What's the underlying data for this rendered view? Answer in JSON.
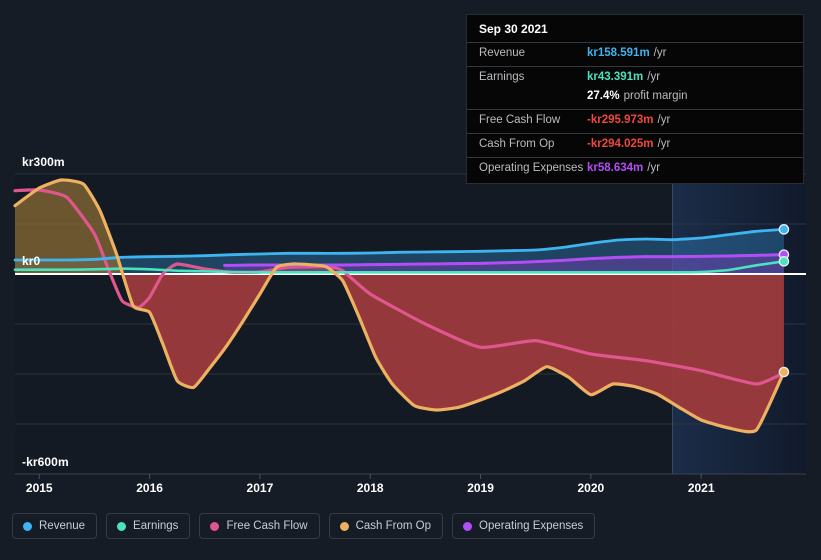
{
  "currency_prefix": "kr",
  "colors": {
    "background": "#151c26",
    "plot_background": "#131a24",
    "forecast_background": "#142034",
    "revenue": "#3eb4f0",
    "earnings": "#4ae3bd",
    "free_cash_flow": "#e0568f",
    "cash_from_op": "#edb161",
    "operating_expenses": "#b24ef5",
    "zero_line": "#ffffff",
    "grid": "#2c333d",
    "negative_fill": "#8d3a3c",
    "tooltip_background": "#060606",
    "tooltip_border": "#2a2d31"
  },
  "tooltip": {
    "title": "Sep 30 2021",
    "rows": [
      {
        "key": "Revenue",
        "value": "kr158.591m",
        "unit": "/yr",
        "color_key": "revenue"
      },
      {
        "key": "Earnings",
        "value": "kr43.391m",
        "unit": "/yr",
        "color_key": "earnings"
      },
      {
        "key": "",
        "value": "27.4%",
        "unit": "profit margin",
        "color_key": "white"
      },
      {
        "key": "Free Cash Flow",
        "value": "-kr295.973m",
        "unit": "/yr",
        "color_key": "negative"
      },
      {
        "key": "Cash From Op",
        "value": "-kr294.025m",
        "unit": "/yr",
        "color_key": "negative"
      },
      {
        "key": "Operating Expenses",
        "value": "kr58.634m",
        "unit": "/yr",
        "color_key": "operating_expenses"
      }
    ]
  },
  "legend": [
    {
      "label": "Revenue",
      "color": "#3eb4f0"
    },
    {
      "label": "Earnings",
      "color": "#4ae3bd"
    },
    {
      "label": "Free Cash Flow",
      "color": "#e0568f"
    },
    {
      "label": "Cash From Op",
      "color": "#edb161"
    },
    {
      "label": "Operating Expenses",
      "color": "#b24ef5"
    }
  ],
  "y_axis": {
    "top_label": "kr300m",
    "zero_label": "kr0",
    "bottom_label": "-kr600m"
  },
  "x_axis": {
    "ticks": [
      "2015",
      "2016",
      "2017",
      "2018",
      "2019",
      "2020",
      "2021"
    ]
  },
  "chart_data": {
    "type": "line",
    "title": "",
    "xlabel": "",
    "ylabel": "",
    "ylim": [
      -600,
      300
    ],
    "xlim": [
      2014.78,
      2021.95
    ],
    "grid": true,
    "legend_position": "bottom",
    "y_ticks": [
      300,
      150,
      0,
      -150,
      -300,
      -450,
      -600
    ],
    "y_tick_labels": [
      "kr300m",
      "",
      "kr0",
      "",
      "",
      "",
      "-kr600m"
    ],
    "x_ticks": [
      2015,
      2016,
      2017,
      2018,
      2019,
      2020,
      2021
    ],
    "forecast_start": 2020.74,
    "units": "millions of kr (NOK)",
    "series": [
      {
        "name": "Revenue",
        "color": "#3eb4f0",
        "x": [
          2014.78,
          2015.0,
          2015.25,
          2015.5,
          2015.75,
          2016.0,
          2016.25,
          2016.5,
          2016.75,
          2017.0,
          2017.25,
          2017.5,
          2017.75,
          2018.0,
          2018.25,
          2018.5,
          2018.75,
          2019.0,
          2019.25,
          2019.5,
          2019.75,
          2020.0,
          2020.25,
          2020.5,
          2020.74,
          2021.0,
          2021.25,
          2021.5,
          2021.75
        ],
        "values": [
          42,
          42,
          42,
          44,
          50,
          52,
          53,
          55,
          58,
          60,
          62,
          62,
          62,
          63,
          65,
          66,
          67,
          68,
          70,
          72,
          80,
          92,
          102,
          105,
          103,
          108,
          118,
          128,
          134
        ]
      },
      {
        "name": "Earnings",
        "color": "#4ae3bd",
        "x": [
          2014.78,
          2015.0,
          2015.25,
          2015.5,
          2015.75,
          2016.0,
          2016.25,
          2016.5,
          2016.75,
          2017.0,
          2017.25,
          2017.5,
          2017.75,
          2018.0,
          2018.25,
          2018.5,
          2018.75,
          2019.0,
          2019.25,
          2019.5,
          2019.75,
          2020.0,
          2020.25,
          2020.5,
          2020.74,
          2021.0,
          2021.25,
          2021.5,
          2021.75
        ],
        "values": [
          13,
          13,
          13,
          14,
          16,
          14,
          10,
          8,
          6,
          5,
          5,
          5,
          5,
          5,
          5,
          5,
          5,
          5,
          5,
          5,
          5,
          5,
          5,
          5,
          5,
          6,
          12,
          26,
          38
        ]
      },
      {
        "name": "Free Cash Flow",
        "color": "#e0568f",
        "x": [
          2014.78,
          2015.0,
          2015.25,
          2015.5,
          2015.62,
          2015.75,
          2015.9,
          2016.0,
          2016.12,
          2016.25,
          2016.5,
          2016.75,
          2017.0,
          2017.25,
          2017.5,
          2017.62,
          2017.75,
          2018.0,
          2018.5,
          2019.0,
          2019.5,
          2020.0,
          2020.5,
          2021.0,
          2021.5,
          2021.75
        ],
        "values": [
          250,
          252,
          230,
          120,
          20,
          -80,
          -100,
          -70,
          0,
          30,
          15,
          5,
          6,
          20,
          22,
          22,
          10,
          -60,
          -150,
          -220,
          -200,
          -240,
          -260,
          -290,
          -330,
          -296
        ]
      },
      {
        "name": "Cash From Op",
        "color": "#edb161",
        "x": [
          2014.78,
          2015.0,
          2015.2,
          2015.4,
          2015.55,
          2015.7,
          2015.85,
          2016.0,
          2016.12,
          2016.25,
          2016.4,
          2016.55,
          2016.7,
          2016.85,
          2017.0,
          2017.15,
          2017.3,
          2017.45,
          2017.6,
          2017.75,
          2017.9,
          2018.05,
          2018.2,
          2018.4,
          2018.6,
          2018.8,
          2019.0,
          2019.2,
          2019.4,
          2019.6,
          2019.8,
          2020.0,
          2020.2,
          2020.4,
          2020.6,
          2020.8,
          2021.0,
          2021.25,
          2021.5,
          2021.75
        ],
        "values": [
          205,
          258,
          282,
          270,
          190,
          60,
          -95,
          -115,
          -210,
          -320,
          -340,
          -280,
          -215,
          -140,
          -60,
          20,
          30,
          28,
          22,
          -20,
          -130,
          -250,
          -330,
          -395,
          -408,
          -400,
          -378,
          -352,
          -320,
          -278,
          -310,
          -362,
          -330,
          -338,
          -360,
          -400,
          -438,
          -462,
          -468,
          -294
        ]
      },
      {
        "name": "Operating Expenses",
        "color": "#b24ef5",
        "x": [
          2016.68,
          2016.75,
          2017.0,
          2017.25,
          2017.5,
          2017.75,
          2018.0,
          2018.25,
          2018.5,
          2018.75,
          2019.0,
          2019.25,
          2019.5,
          2019.75,
          2020.0,
          2020.25,
          2020.5,
          2020.74,
          2021.0,
          2021.25,
          2021.5,
          2021.75
        ],
        "values": [
          26,
          26,
          27,
          27,
          27,
          27,
          28,
          29,
          30,
          31,
          32,
          34,
          37,
          41,
          46,
          50,
          52,
          52,
          53,
          54,
          56,
          58
        ]
      }
    ],
    "endpoint_markers": [
      {
        "series": "Revenue",
        "x": 2021.75,
        "y": 134
      },
      {
        "series": "Operating Expenses",
        "x": 2021.75,
        "y": 58
      },
      {
        "series": "Earnings",
        "x": 2021.75,
        "y": 38
      },
      {
        "series": "Cash From Op",
        "x": 2021.75,
        "y": -294
      }
    ]
  }
}
